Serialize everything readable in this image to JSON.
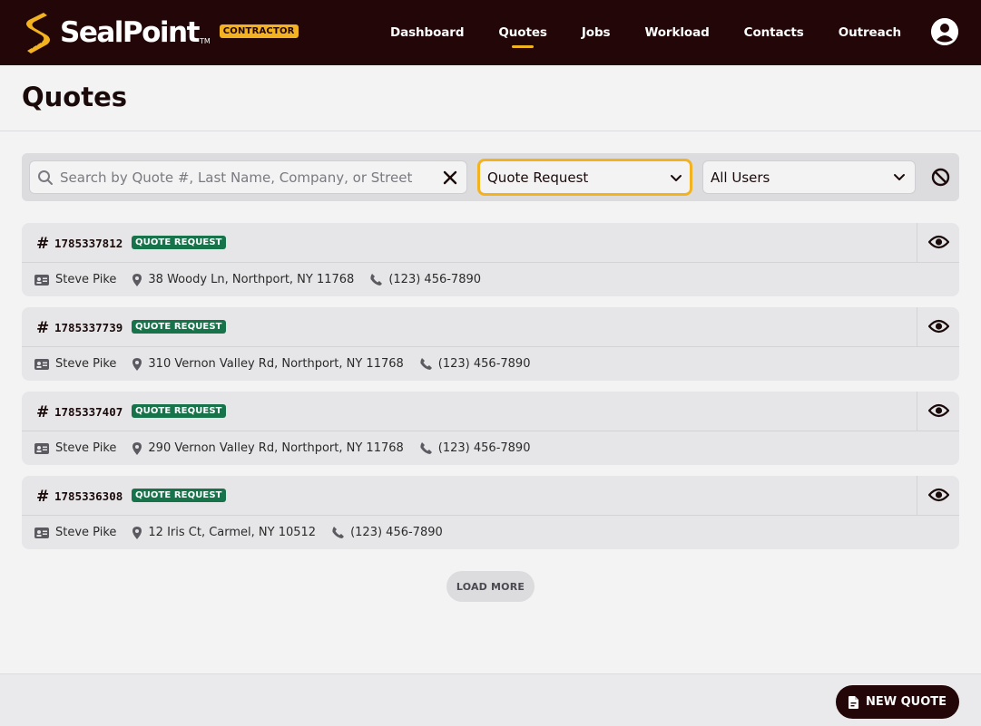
{
  "app": {
    "brand": "SealPoint",
    "brand_tm": "TM",
    "brand_badge": "CONTRACTOR",
    "brand_color": "#230607",
    "accent_color": "#f3b321"
  },
  "nav": {
    "items": [
      {
        "label": "Dashboard",
        "active": false
      },
      {
        "label": "Quotes",
        "active": true
      },
      {
        "label": "Jobs",
        "active": false
      },
      {
        "label": "Workload",
        "active": false
      },
      {
        "label": "Contacts",
        "active": false
      },
      {
        "label": "Outreach",
        "active": false
      }
    ],
    "avatar_icon": "user-circle-icon"
  },
  "page": {
    "title": "Quotes"
  },
  "filters": {
    "search": {
      "value": "",
      "placeholder": "Search by Quote #, Last Name, Company, or Street"
    },
    "status_select": {
      "value": "Quote Request"
    },
    "user_select": {
      "value": "All Users"
    }
  },
  "quotes": [
    {
      "number": "1785337812",
      "status": "QUOTE REQUEST",
      "name": "Steve Pike",
      "address": "38 Woody Ln, Northport, NY 11768",
      "phone": "(123) 456-7890"
    },
    {
      "number": "1785337739",
      "status": "QUOTE REQUEST",
      "name": "Steve Pike",
      "address": "310 Vernon Valley Rd, Northport, NY 11768",
      "phone": "(123) 456-7890"
    },
    {
      "number": "1785337407",
      "status": "QUOTE REQUEST",
      "name": "Steve Pike",
      "address": "290 Vernon Valley Rd, Northport, NY 11768",
      "phone": "(123) 456-7890"
    },
    {
      "number": "1785336308",
      "status": "QUOTE REQUEST",
      "name": "Steve Pike",
      "address": "12 Iris Ct, Carmel, NY 10512",
      "phone": "(123) 456-7890"
    }
  ],
  "status_color": "#17734a",
  "actions": {
    "load_more": "LOAD MORE",
    "new_quote": "NEW QUOTE"
  }
}
